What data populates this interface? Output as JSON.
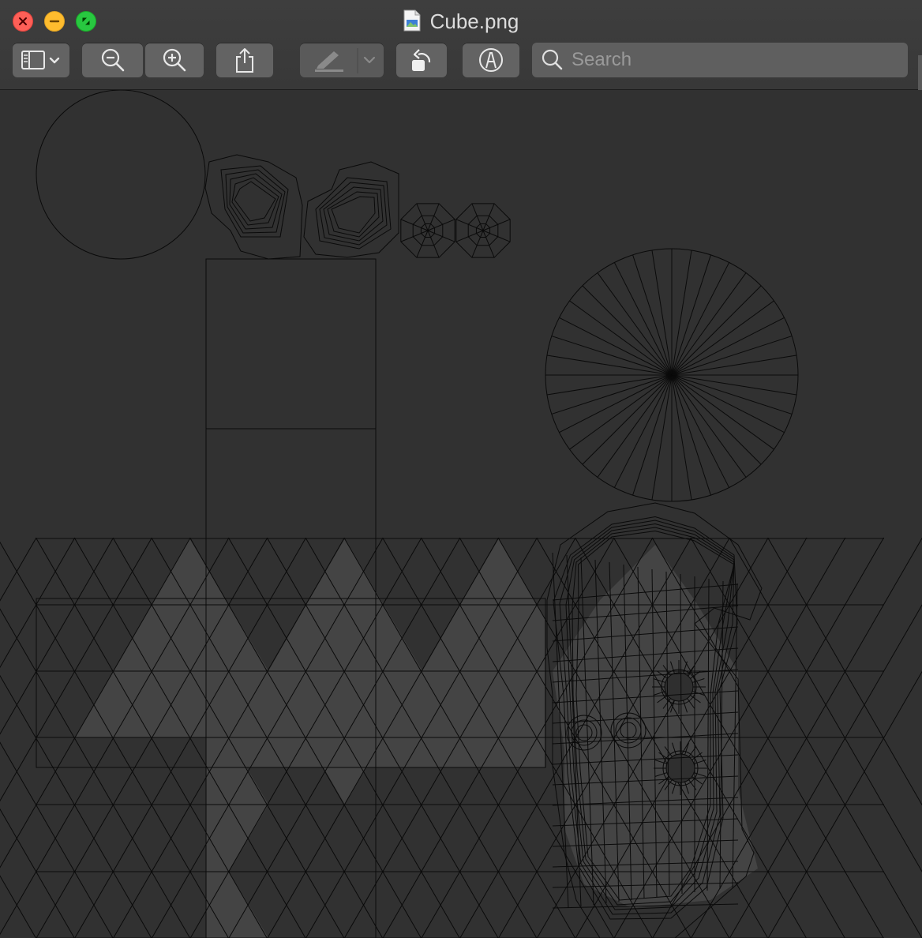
{
  "window": {
    "title": "Cube.png"
  },
  "toolbar": {
    "sidebar_toggle": "sidebar-chevron",
    "zoom_out": "zoom-out",
    "zoom_in": "zoom-in",
    "share": "share",
    "markup_pen": "highlight",
    "rotate": "rotate-left",
    "annotate": "markup"
  },
  "search": {
    "placeholder": "Search"
  },
  "colors": {
    "close": "#fe5f57",
    "minimize": "#febc2e",
    "maximize": "#28c840",
    "canvas": "#313131",
    "overlay": "#444444",
    "line": "#0a0a0a"
  }
}
